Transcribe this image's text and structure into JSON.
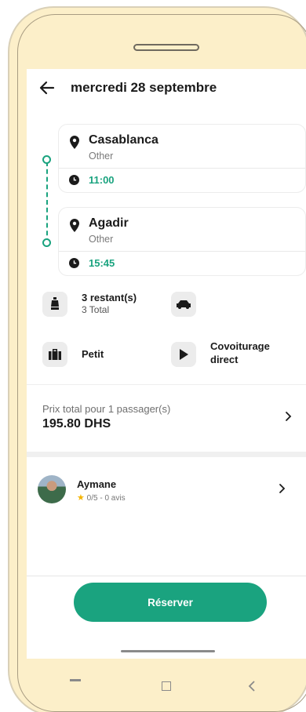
{
  "header": {
    "title": "mercredi 28 septembre"
  },
  "route": {
    "departure": {
      "city": "Casablanca",
      "sub": "Other",
      "time": "11:00"
    },
    "arrival": {
      "city": "Agadir",
      "sub": "Other",
      "time": "15:45"
    }
  },
  "info": {
    "seats_left": "3 restant(s)",
    "seats_total": "3 Total",
    "luggage": "Petit",
    "ride_type": "Covoiturage direct"
  },
  "price": {
    "label": "Prix total pour 1 passager(s)",
    "value": "195.80 DHS"
  },
  "driver": {
    "name": "Aymane",
    "rating": "0/5 - 0 avis"
  },
  "actions": {
    "reserve_label": "Réserver"
  },
  "colors": {
    "accent": "#1aa37f",
    "frame": "#fcefc9",
    "icon_bg": "#ececec"
  },
  "icons": [
    "back-arrow-icon",
    "map-pin-icon",
    "clock-icon",
    "seat-icon",
    "car-icon",
    "luggage-icon",
    "play-icon",
    "chevron-right-icon",
    "star-icon"
  ]
}
